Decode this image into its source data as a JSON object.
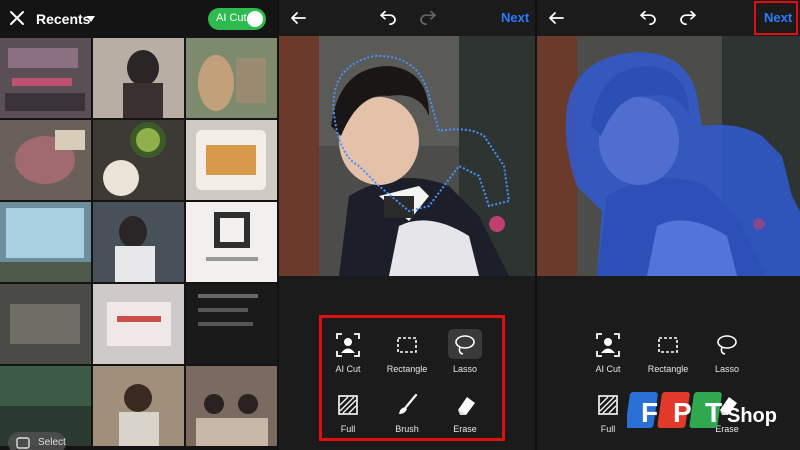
{
  "gallery": {
    "title": "Recents",
    "ai_cut_label": "AI Cut",
    "ai_cut_on": true,
    "select_label": "Select",
    "colors": {
      "toggle": "#2dbb4f"
    }
  },
  "editor": {
    "next_label": "Next",
    "tools": {
      "ai_cut": "AI Cut",
      "rectangle": "Rectangle",
      "lasso": "Lasso",
      "full": "Full",
      "brush": "Brush",
      "erase": "Erase"
    },
    "colors": {
      "accent": "#2a7cff",
      "highlight": "#e01010"
    }
  },
  "watermark": {
    "brand": "FPT",
    "suffix": "Shop"
  }
}
